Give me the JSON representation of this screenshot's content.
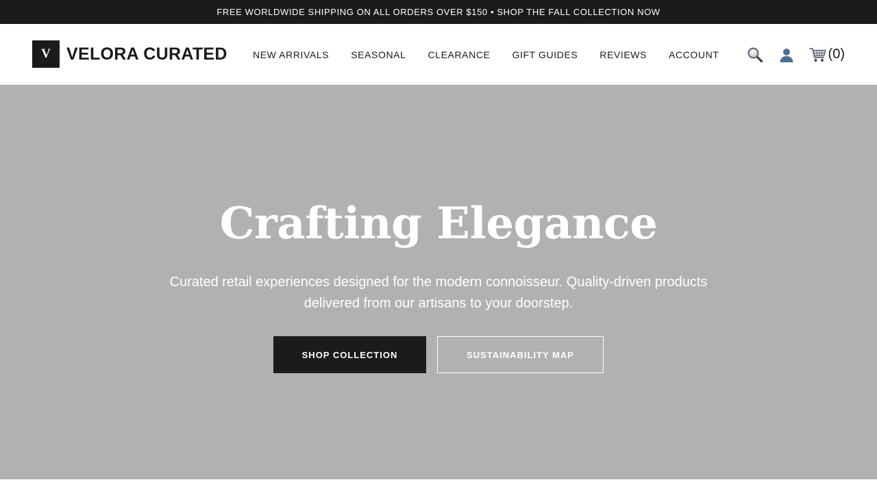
{
  "announcement": {
    "text": "FREE WORLDWIDE SHIPPING ON ALL ORDERS OVER $150 • SHOP THE FALL COLLECTION NOW"
  },
  "header": {
    "logo_mark": "V",
    "brand_name": "VELORA CURATED",
    "nav": [
      {
        "label": "NEW ARRIVALS"
      },
      {
        "label": "SEASONAL"
      },
      {
        "label": "CLEARANCE"
      },
      {
        "label": "GIFT GUIDES"
      },
      {
        "label": "REVIEWS"
      },
      {
        "label": "ACCOUNT"
      }
    ],
    "actions": {
      "search_icon": "search-icon",
      "account_icon": "user-icon",
      "cart_icon": "cart-icon",
      "cart_count": "(0)"
    }
  },
  "hero": {
    "title": "Crafting Elegance",
    "subtitle": "Curated retail experiences designed for the modern connoisseur. Quality-driven products delivered from our artisans to your doorstep.",
    "primary_button": "SHOP COLLECTION",
    "secondary_button": "SUSTAINABILITY MAP"
  },
  "colors": {
    "announcement_bg": "#1b1b1b",
    "hero_bg": "#b1b1b1",
    "primary_button_bg": "#1b1b1b",
    "text_dark": "#1a1a1a",
    "text_light": "#ffffff"
  }
}
